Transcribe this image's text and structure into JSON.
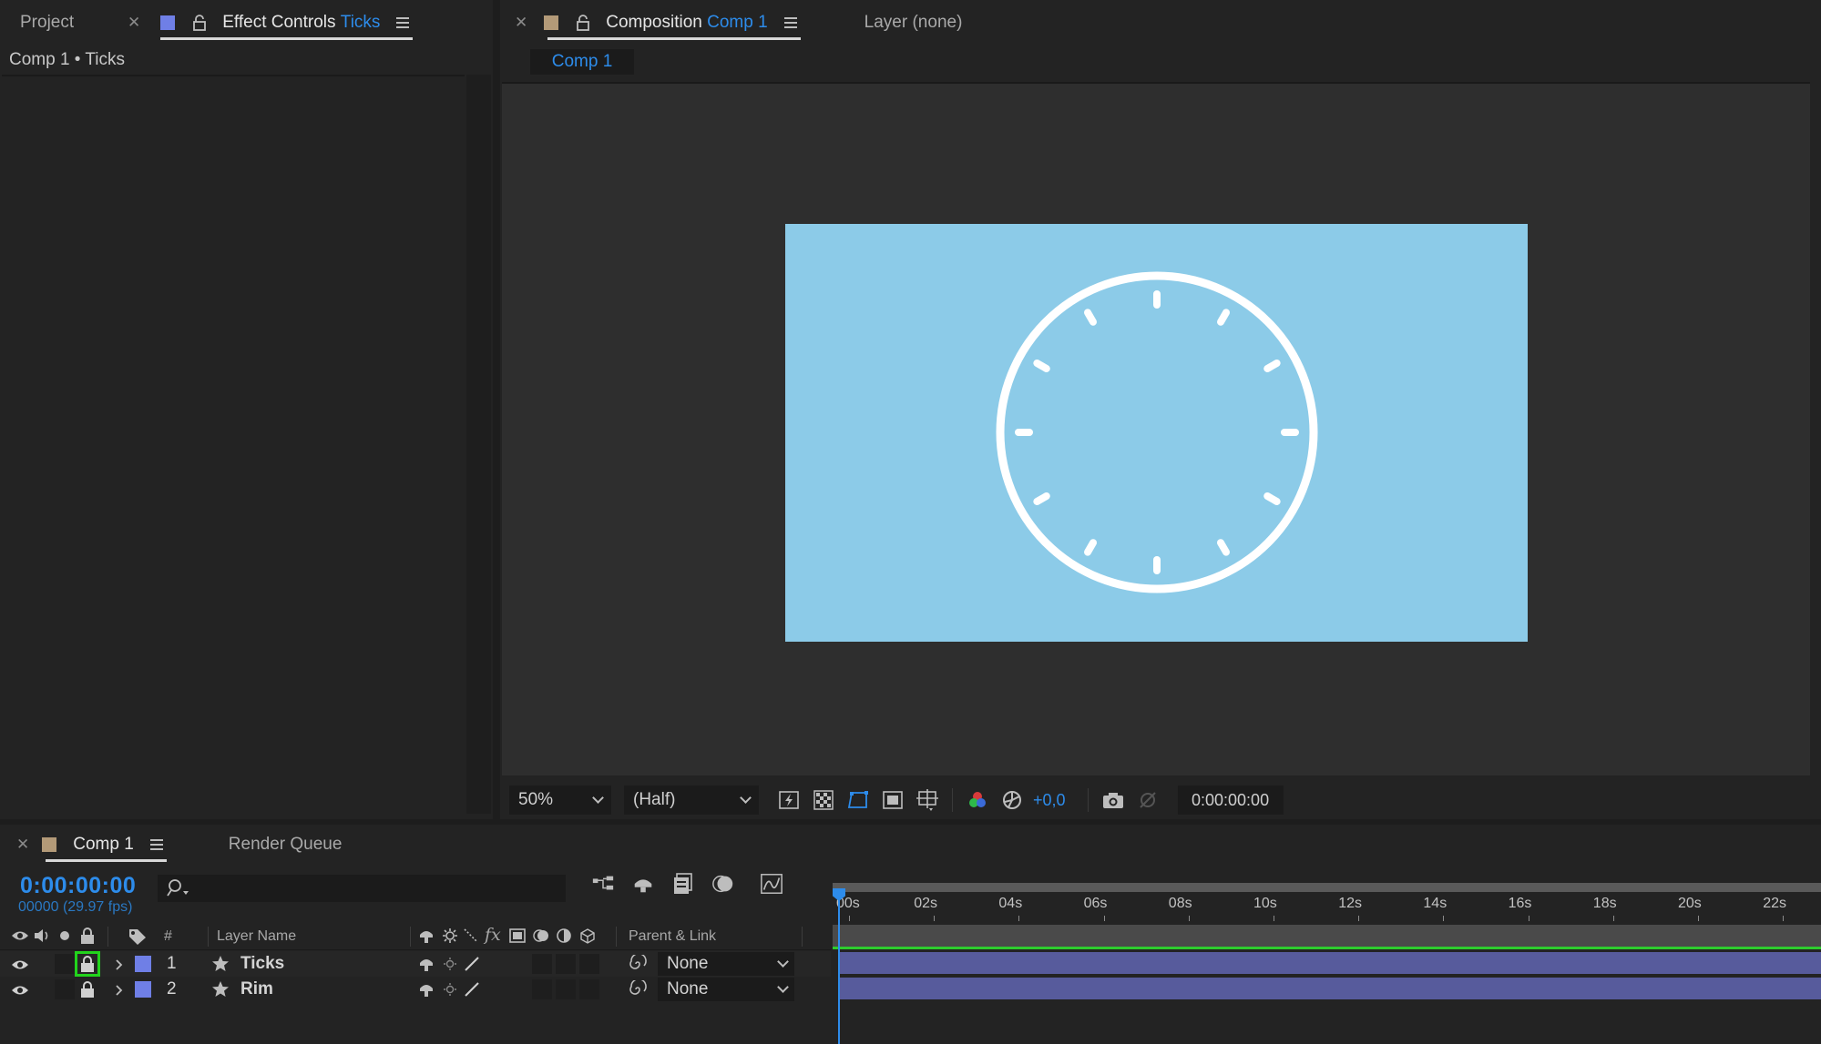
{
  "left_panel": {
    "tabs": [
      {
        "label": "Project"
      },
      {
        "label": "Effect Controls",
        "target": "Ticks"
      }
    ],
    "breadcrumb": "Comp 1 • Ticks"
  },
  "composition_panel": {
    "tab_label": "Composition",
    "tab_target": "Comp 1",
    "layer_tab": "Layer (none)",
    "subtab": "Comp 1",
    "canvas_color": "#8ccbe8",
    "toolbar": {
      "zoom": "50%",
      "resolution": "(Half)",
      "exposure": "+0,0",
      "timecode": "0:00:00:00"
    }
  },
  "timeline": {
    "tabs": [
      {
        "label": "Comp 1"
      },
      {
        "label": "Render Queue"
      }
    ],
    "current_time": "0:00:00:00",
    "frame_info": "00000 (29.97 fps)",
    "columns": {
      "number": "#",
      "layer_name": "Layer Name",
      "parent": "Parent & Link"
    },
    "layers": [
      {
        "number": "1",
        "name": "Ticks",
        "parent": "None",
        "locked": true
      },
      {
        "number": "2",
        "name": "Rim",
        "parent": "None",
        "locked": true
      }
    ],
    "ruler": [
      "00s",
      "02s",
      "04s",
      "06s",
      "08s",
      "10s",
      "12s",
      "14s",
      "16s",
      "18s",
      "20s",
      "22s"
    ]
  },
  "colors": {
    "accent": "#2d8ceb",
    "layer_label": "#6f7fe6",
    "layer_bar": "#575b9c",
    "highlight": "#2ecc2e"
  }
}
